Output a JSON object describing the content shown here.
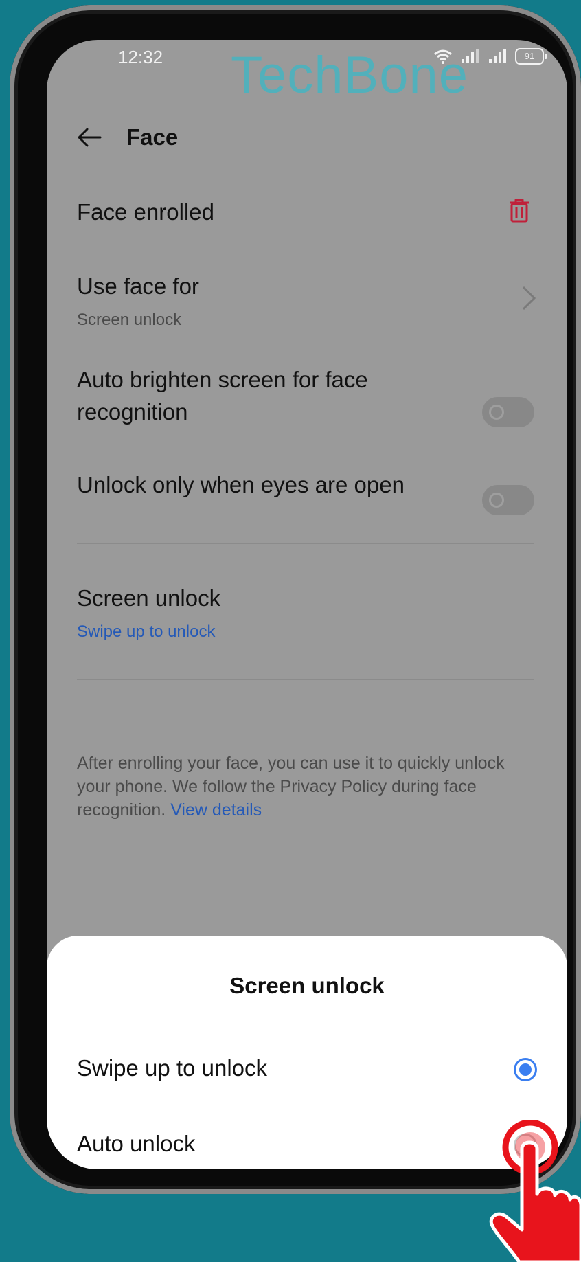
{
  "status_bar": {
    "time": "12:32",
    "battery": "91"
  },
  "watermark": "TechBone",
  "header": {
    "title": "Face"
  },
  "settings": {
    "face_enrolled": "Face enrolled",
    "use_face_for": {
      "label": "Use face for",
      "value": "Screen unlock"
    },
    "auto_brighten": {
      "label_line1": "Auto brighten screen for face",
      "label_line2": "recognition",
      "enabled": false
    },
    "eyes_open": {
      "label": "Unlock only when eyes are open",
      "enabled": false
    },
    "screen_unlock": {
      "label": "Screen unlock",
      "value": "Swipe up to unlock"
    },
    "info": {
      "text": "After enrolling your face, you can use it to quickly unlock your phone. We follow the Privacy Policy during face recognition.",
      "link": "View details"
    }
  },
  "sheet": {
    "title": "Screen unlock",
    "options": [
      {
        "label": "Swipe up to unlock",
        "selected": true
      },
      {
        "label": "Auto unlock",
        "selected": false
      }
    ]
  },
  "colors": {
    "accent": "#3a7ef0",
    "link": "#2459b7",
    "delete": "#c0203a",
    "background": "#127b8a",
    "watermark": "#4fb2bd",
    "tap_hand": "#e8141c"
  },
  "icons": [
    "back-arrow-icon",
    "wifi-icon",
    "signal-icon",
    "battery-icon",
    "trash-icon",
    "chevron-right-icon",
    "tap-hand-icon"
  ]
}
